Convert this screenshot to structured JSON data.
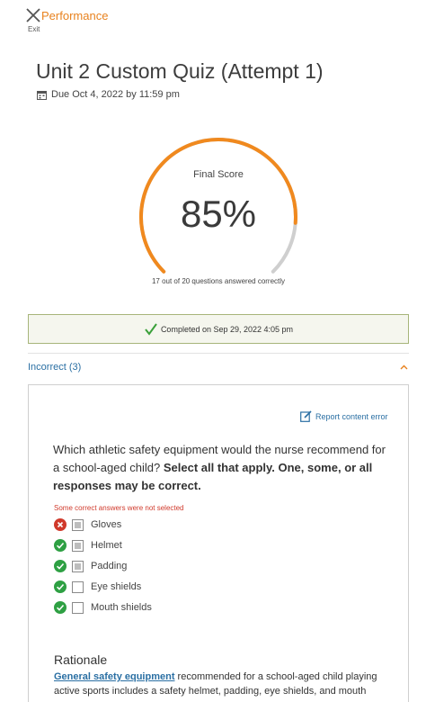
{
  "header": {
    "title": "Performance",
    "exit_label": "Exit",
    "exit_icon": "close-icon",
    "accent_color": "#e8821e"
  },
  "quiz": {
    "title": "Unit 2 Custom Quiz (Attempt 1)",
    "due": "Due Oct 4, 2022 by 11:59 pm",
    "due_icon": "calendar-icon"
  },
  "score": {
    "label": "Final Score",
    "value": "85%",
    "fraction": 0.85,
    "note": "17 out of 20 questions answered correctly",
    "fill_color": "#f0891e",
    "track_color": "#cfcfcf"
  },
  "completed": {
    "text": "Completed on Sep 29, 2022 4:05 pm",
    "icon": "check-icon",
    "icon_color": "#3aa03a"
  },
  "incorrect_section": {
    "label": "Incorrect (3)",
    "icon": "chevron-up-icon"
  },
  "question": {
    "report_label": "Report content error",
    "report_icon": "edit-icon",
    "prompt": "Which athletic safety equipment would the nurse recommend for a school-aged child?",
    "instruction": "Select all that apply. One, some, or all responses may be correct.",
    "feedback": "Some correct answers were not selected",
    "options": [
      {
        "label": "Gloves",
        "status": "incorrect",
        "checked": true
      },
      {
        "label": "Helmet",
        "status": "correct",
        "checked": true
      },
      {
        "label": "Padding",
        "status": "correct",
        "checked": true
      },
      {
        "label": "Eye shields",
        "status": "correct",
        "checked": false
      },
      {
        "label": "Mouth shields",
        "status": "correct",
        "checked": false
      }
    ],
    "colors": {
      "correct": "#2ea043",
      "incorrect": "#d0392b"
    }
  },
  "rationale": {
    "title": "Rationale",
    "link_text": "General safety equipment",
    "text": " recommended for a school-aged child playing active sports includes a safety helmet, padding, eye shields, and mouth"
  }
}
